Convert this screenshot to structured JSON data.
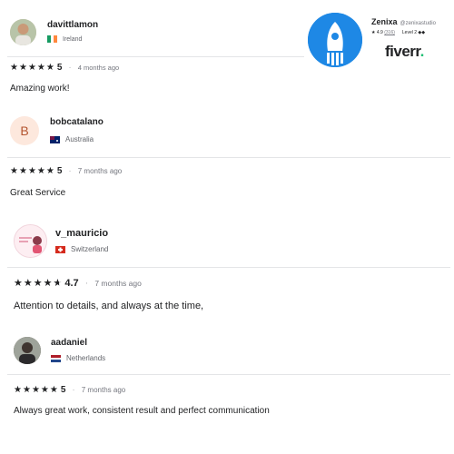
{
  "seller": {
    "name": "Zenixa",
    "handle": "@zenixastudio",
    "rating": "★ 4.9",
    "reviews_count": "(316)",
    "level": "Level 2 ◆◆",
    "brand": "fiverr",
    "brand_dot": ".",
    "logo_bg": "#1e88e5"
  },
  "reviews": [
    {
      "username": "davittlamon",
      "country": "Ireland",
      "stars": 5,
      "score": "5",
      "date": "4 months ago",
      "comment": "Amazing work!"
    },
    {
      "username": "bobcatalano",
      "avatar_letter": "B",
      "country": "Australia",
      "stars": 5,
      "score": "5",
      "date": "7 months ago",
      "comment": "Great Service"
    },
    {
      "username": "v_mauricio",
      "country": "Switzerland",
      "stars": 4.7,
      "score": "4.7",
      "date": "7 months ago",
      "comment": "Attention to details, and always at the time,"
    },
    {
      "username": "aadaniel",
      "country": "Netherlands",
      "stars": 5,
      "score": "5",
      "date": "7 months ago",
      "comment": "Always great work, consistent result and perfect communication"
    }
  ],
  "colors": {
    "star": "#222325",
    "divider": "#e4e5e7",
    "brand_green": "#1dbf73",
    "avatar_b_bg": "#fde8dd",
    "avatar_b_text": "#b45530"
  }
}
